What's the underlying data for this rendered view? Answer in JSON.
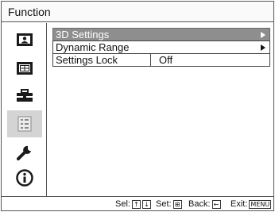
{
  "header": {
    "title": "Function"
  },
  "sidebar": {
    "items": [
      {
        "icon": "picture-icon",
        "selected": false
      },
      {
        "icon": "screen-icon",
        "selected": false
      },
      {
        "icon": "setup-icon",
        "selected": false
      },
      {
        "icon": "function-icon",
        "selected": true
      },
      {
        "icon": "wrench-icon",
        "selected": false
      },
      {
        "icon": "information-icon",
        "selected": false
      }
    ]
  },
  "menu": {
    "items": [
      {
        "label": "3D Settings",
        "value": "",
        "submenu": true
      },
      {
        "label": "Dynamic Range",
        "value": "",
        "submenu": true
      },
      {
        "label": "Settings Lock",
        "value": "Off",
        "submenu": false
      }
    ]
  },
  "footer": {
    "sel_label": "Sel:",
    "set_label": "Set:",
    "back_label": "Back:",
    "exit_label": "Exit:",
    "up_key": "↑",
    "down_key": "↓",
    "set_key": "⊞",
    "back_key": "←",
    "exit_key": "MENU"
  }
}
